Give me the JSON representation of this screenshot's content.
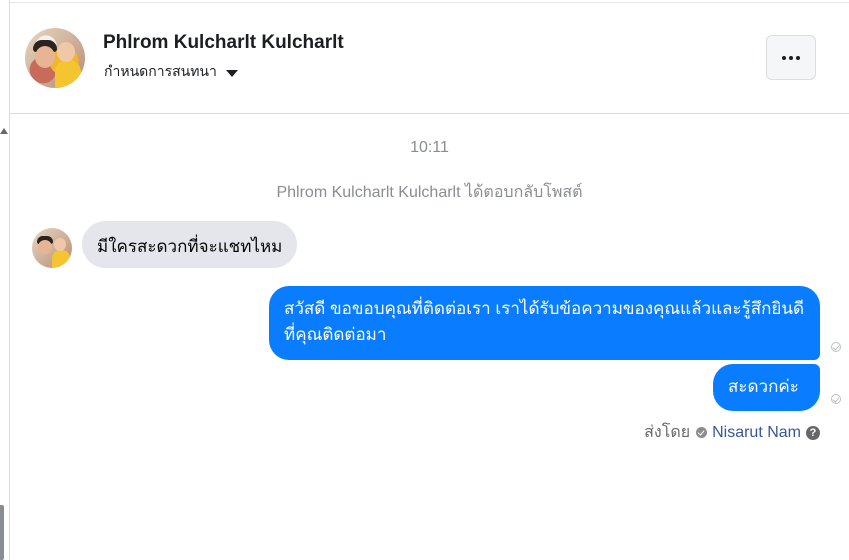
{
  "header": {
    "contact_name": "Phlrom Kulcharlt Kulcharlt",
    "settings_label": "กำหนดการสนทนา",
    "more_label": "···"
  },
  "thread": {
    "timestamp": "10:11",
    "system_message": "Phlrom Kulcharlt Kulcharlt ได้ตอบกลับโพสต์",
    "messages": [
      {
        "direction": "incoming",
        "text": "มีใครสะดวกที่จะแชทไหม"
      },
      {
        "direction": "outgoing",
        "text": "สวัสดี ขอขอบคุณที่ติดต่อเรา เราได้รับข้อความของคุณแล้วและรู้สึกยินดีที่คุณติดต่อมา"
      },
      {
        "direction": "outgoing",
        "text": "สะดวกค่ะ"
      }
    ],
    "sent_by_label": "ส่งโดย",
    "sent_by_name": "Nisarut Nam",
    "help_glyph": "?"
  },
  "colors": {
    "outgoing_bubble": "#0a7cff",
    "incoming_bubble": "#e4e6eb",
    "muted_text": "#8a8d91",
    "link": "#385898"
  },
  "icons": [
    "more-dots-icon",
    "caret-down-icon",
    "seen-check-icon",
    "verified-check-icon",
    "help-icon"
  ]
}
